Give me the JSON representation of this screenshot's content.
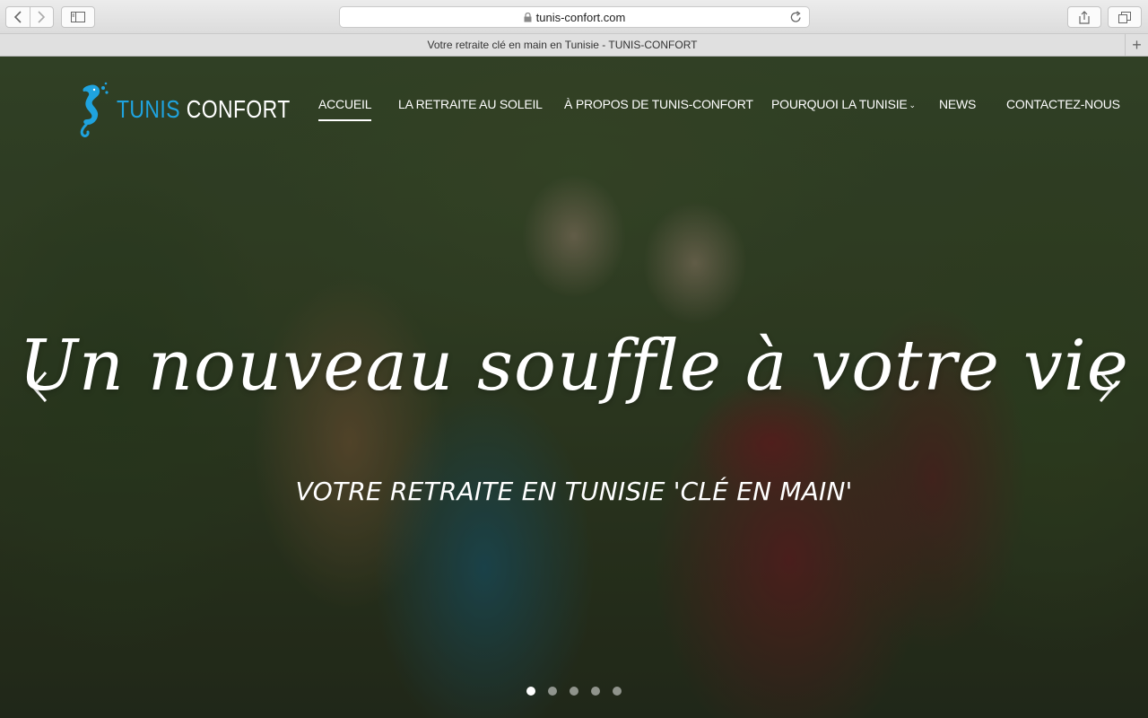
{
  "browser": {
    "url": "tunis-confort.com",
    "tab_title": "Votre retraite clé en main en Tunisie - TUNIS-CONFORT",
    "icons": [
      "back-icon",
      "forward-icon",
      "sidebar-icon",
      "lock-icon",
      "reload-icon",
      "share-icon",
      "tabs-overview-icon",
      "new-tab-icon"
    ]
  },
  "site": {
    "logo": {
      "part1": "TUNIS",
      "part2": "CONFORT",
      "accent_color": "#1fa3df"
    },
    "nav": {
      "home": "ACCUEIL",
      "retirement": "LA RETRAITE AU SOLEIL",
      "about": "À PROPOS DE TUNIS-CONFORT",
      "why_tunisia": "POURQUOI LA TUNISIE",
      "news": "NEWS",
      "contact": "CONTACTEZ-NOUS"
    }
  },
  "hero": {
    "title": "Un nouveau souffle à votre vie",
    "subtitle": "VOTRE RETRAITE EN TUNISIE 'CLÉ EN MAIN'",
    "slides_count": 5,
    "active_slide": 1
  }
}
